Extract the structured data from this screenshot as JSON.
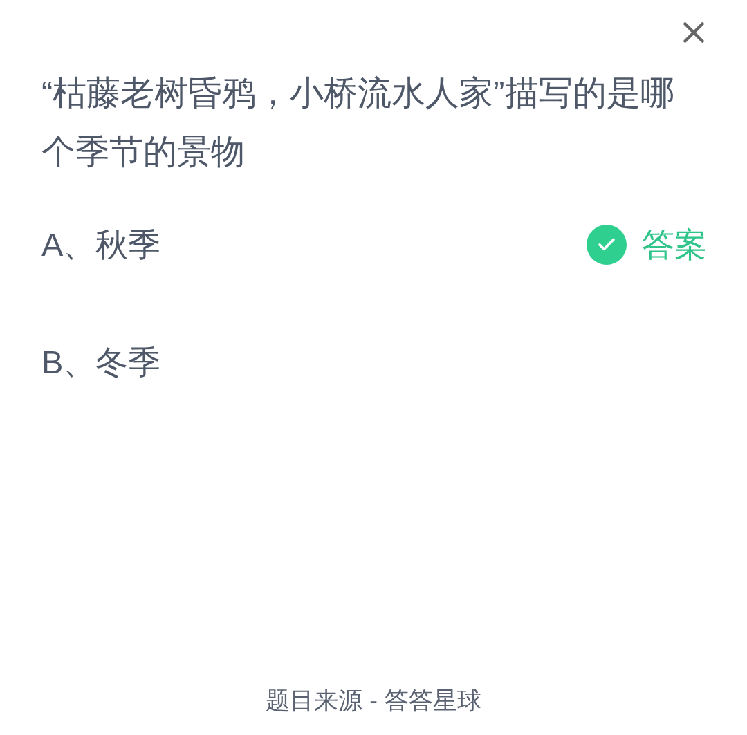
{
  "question": "“枯藤老树昏鸦，小桥流水人家”描写的是哪个季节的景物",
  "answer_badge": "答案",
  "options": [
    {
      "label": "A、秋季",
      "correct": true
    },
    {
      "label": "B、冬季",
      "correct": false
    }
  ],
  "footer": "题目来源 - 答答星球"
}
